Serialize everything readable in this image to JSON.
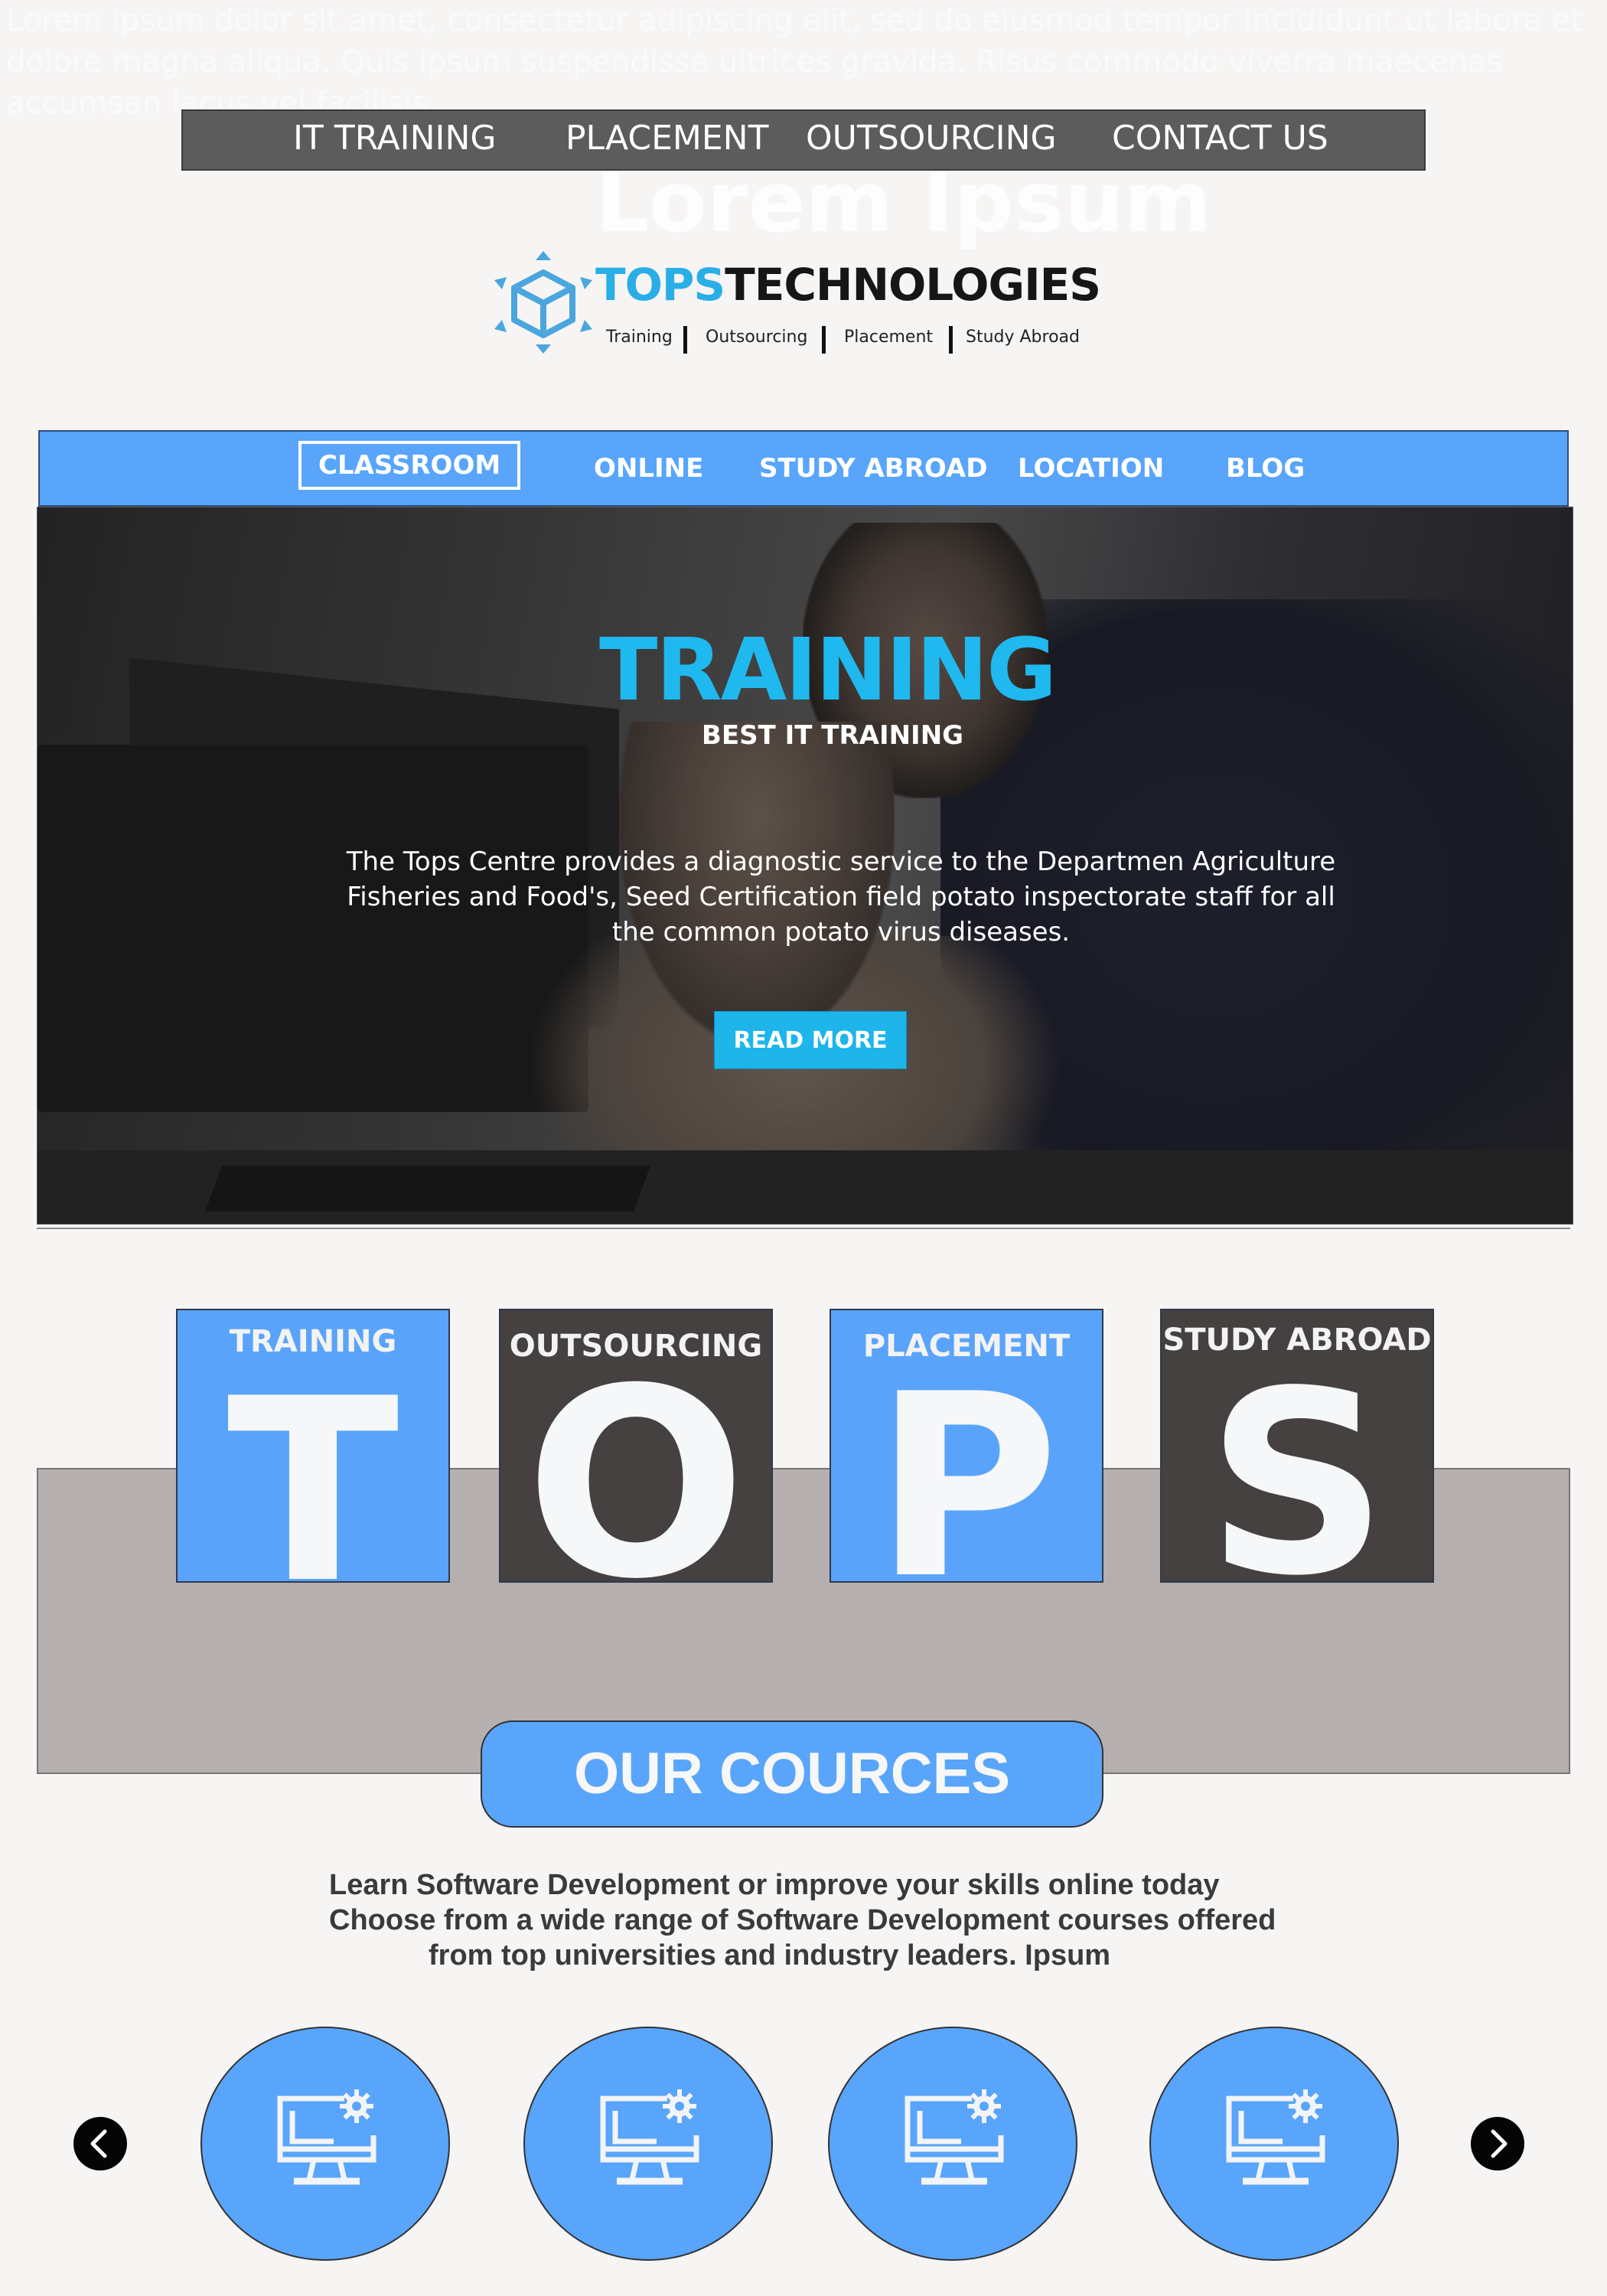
{
  "background_text": {
    "lorem_paragraph": "Lorem ipsum dolor sit amet, consectetur adipiscing elit, sed do eiusmod tempor incididunt ut labore et dolore magna aliqua. Quis ipsum suspendisse ultrices gravida. Risus commodo viverra maecenas accumsan lacus vel facilisis.",
    "lorem_heading": "Lorem Ipsum"
  },
  "top_nav": {
    "items": [
      {
        "label": "IT TRAINING"
      },
      {
        "label": "PLACEMENT"
      },
      {
        "label": "OUTSOURCING"
      },
      {
        "label": "CONTACT US"
      }
    ]
  },
  "logo": {
    "brand_part1": "TOPS",
    "brand_part2": "TECHNOLOGIES",
    "tagline": [
      "Training",
      "Outsourcing",
      "Placement",
      "Study Abroad"
    ]
  },
  "secondary_nav": {
    "items": [
      {
        "label": "CLASSROOM",
        "active": true
      },
      {
        "label": "ONLINE"
      },
      {
        "label": "STUDY ABROAD"
      },
      {
        "label": "LOCATION"
      },
      {
        "label": "BLOG"
      }
    ]
  },
  "hero": {
    "title": "TRAINING",
    "subtitle": "BEST IT  TRAINING",
    "body_lines": [
      "The Tops Centre provides a diagnostic service to the Departmen Agriculture",
      "Fisheries and Food's, Seed Certification field potato inspectorate staff for all",
      "the common potato virus diseases."
    ],
    "cta": "READ MORE"
  },
  "tiles": [
    {
      "caption": "TRAINING",
      "letter": "T",
      "style": "blue"
    },
    {
      "caption": "OUTSOURCING",
      "letter": "O",
      "style": "dark"
    },
    {
      "caption": "PLACEMENT",
      "letter": "P",
      "style": "blue"
    },
    {
      "caption": "STUDY ABROAD",
      "letter": "S",
      "style": "dark"
    }
  ],
  "courses": {
    "heading": "OUR COURCES",
    "description_lines": [
      "Learn Software Development or improve your skills online today",
      "Choose from a wide range of Software Development courses offered",
      "from top universities and industry leaders. Ipsum"
    ],
    "items": [
      {
        "icon": "computer-settings-icon"
      },
      {
        "icon": "computer-settings-icon"
      },
      {
        "icon": "computer-settings-icon"
      },
      {
        "icon": "computer-settings-icon"
      }
    ],
    "prev_icon": "chevron-left-icon",
    "next_icon": "chevron-right-icon"
  },
  "colors": {
    "accent_blue": "#58a5fb",
    "hero_title": "#1fb8ef",
    "dark_tile": "#454141",
    "band": "#b6afaf",
    "top_nav": "#5c5c5c"
  }
}
